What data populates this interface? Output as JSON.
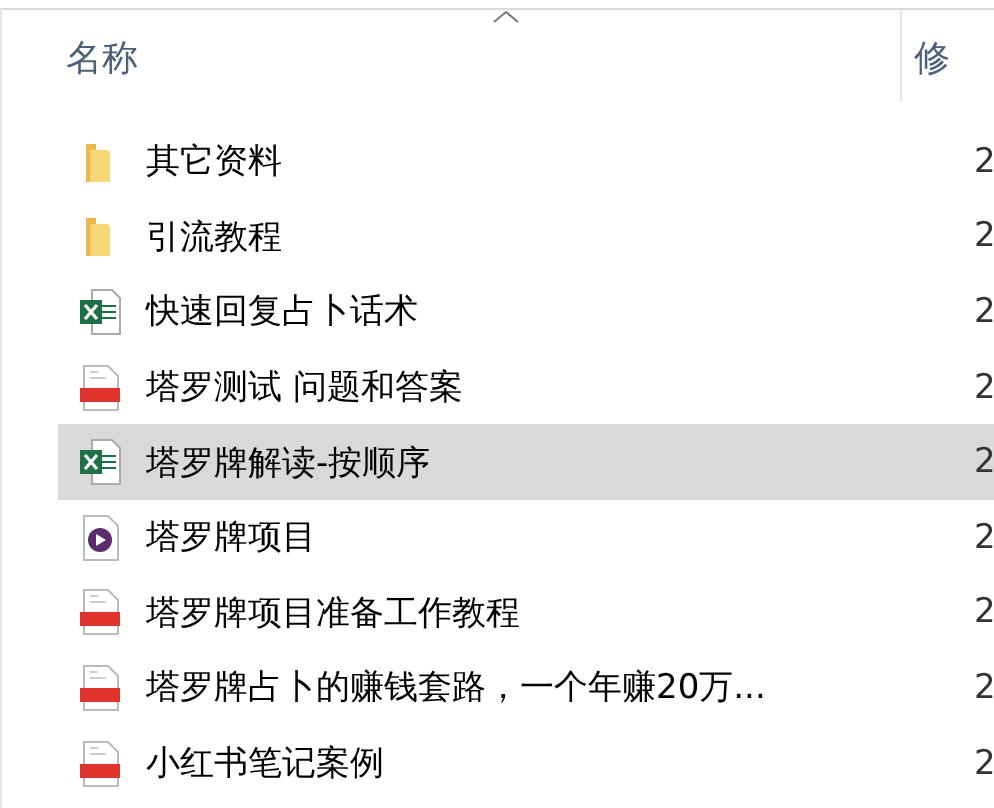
{
  "table": {
    "columns": [
      {
        "label": "名称",
        "sorted": true
      },
      {
        "label": "修"
      }
    ],
    "rows": [
      {
        "kind": "folder",
        "name": "其它资料",
        "column_2": "2",
        "selected": false
      },
      {
        "kind": "folder",
        "name": "引流教程",
        "column_2": "2",
        "selected": false
      },
      {
        "kind": "excel",
        "name": "快速回复占卜话术",
        "column_2": "2",
        "selected": false
      },
      {
        "kind": "pdf",
        "name": "塔罗测试 问题和答案",
        "column_2": "2",
        "selected": false
      },
      {
        "kind": "excel",
        "name": "塔罗牌解读-按顺序",
        "column_2": "2",
        "selected": true
      },
      {
        "kind": "video",
        "name": "塔罗牌项目",
        "column_2": "2",
        "selected": false
      },
      {
        "kind": "pdf",
        "name": "塔罗牌项目准备工作教程",
        "column_2": "2",
        "selected": false
      },
      {
        "kind": "pdf",
        "name": "塔罗牌占卜的赚钱套路，一个年赚20万...",
        "column_2": "2",
        "selected": false
      },
      {
        "kind": "pdf",
        "name": "小红书笔记案例",
        "column_2": "2",
        "selected": false
      }
    ]
  }
}
